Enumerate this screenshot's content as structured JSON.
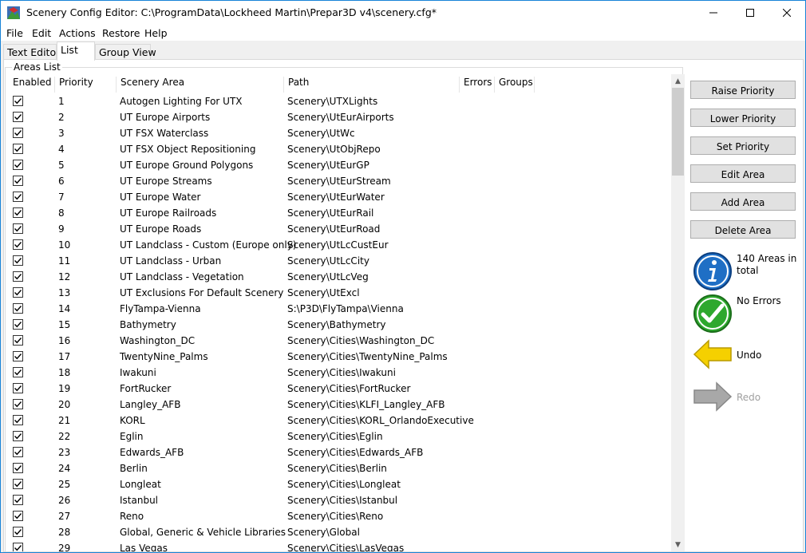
{
  "window": {
    "title": "Scenery Config Editor: C:\\ProgramData\\Lockheed Martin\\Prepar3D v4\\scenery.cfg*"
  },
  "menu": [
    "File",
    "Edit",
    "Actions",
    "Restore",
    "Help"
  ],
  "tabs": [
    {
      "label": "Text Editor",
      "active": false
    },
    {
      "label": "List",
      "active": true
    },
    {
      "label": "Group View",
      "active": false
    }
  ],
  "areas_list": {
    "group_label": "Areas List",
    "columns": [
      "Enabled",
      "Priority",
      "Scenery Area",
      "Path",
      "Errors",
      "Groups"
    ],
    "rows": [
      {
        "priority": "1",
        "area": "Autogen Lighting For UTX",
        "path": "Scenery\\UTXLights"
      },
      {
        "priority": "2",
        "area": "UT Europe Airports",
        "path": "Scenery\\UtEurAirports"
      },
      {
        "priority": "3",
        "area": "UT FSX Waterclass",
        "path": "Scenery\\UtWc"
      },
      {
        "priority": "4",
        "area": "UT FSX Object Repositioning",
        "path": "Scenery\\UtObjRepo"
      },
      {
        "priority": "5",
        "area": "UT Europe Ground Polygons",
        "path": "Scenery\\UtEurGP"
      },
      {
        "priority": "6",
        "area": "UT Europe Streams",
        "path": "Scenery\\UtEurStream"
      },
      {
        "priority": "7",
        "area": "UT Europe Water",
        "path": "Scenery\\UtEurWater"
      },
      {
        "priority": "8",
        "area": "UT Europe Railroads",
        "path": "Scenery\\UtEurRail"
      },
      {
        "priority": "9",
        "area": "UT Europe Roads",
        "path": "Scenery\\UtEurRoad"
      },
      {
        "priority": "10",
        "area": "UT Landclass - Custom (Europe only)",
        "path": "Scenery\\UtLcCustEur"
      },
      {
        "priority": "11",
        "area": "UT Landclass - Urban",
        "path": "Scenery\\UtLcCity"
      },
      {
        "priority": "12",
        "area": "UT Landclass - Vegetation",
        "path": "Scenery\\UtLcVeg"
      },
      {
        "priority": "13",
        "area": "UT Exclusions For Default Scenery",
        "path": "Scenery\\UtExcl"
      },
      {
        "priority": "14",
        "area": "FlyTampa-Vienna",
        "path": "S:\\P3D\\FlyTampa\\Vienna"
      },
      {
        "priority": "15",
        "area": "Bathymetry",
        "path": "Scenery\\Bathymetry"
      },
      {
        "priority": "16",
        "area": "Washington_DC",
        "path": "Scenery\\Cities\\Washington_DC"
      },
      {
        "priority": "17",
        "area": "TwentyNine_Palms",
        "path": "Scenery\\Cities\\TwentyNine_Palms"
      },
      {
        "priority": "18",
        "area": "Iwakuni",
        "path": "Scenery\\Cities\\Iwakuni"
      },
      {
        "priority": "19",
        "area": "FortRucker",
        "path": "Scenery\\Cities\\FortRucker"
      },
      {
        "priority": "20",
        "area": "Langley_AFB",
        "path": "Scenery\\Cities\\KLFI_Langley_AFB"
      },
      {
        "priority": "21",
        "area": "KORL",
        "path": "Scenery\\Cities\\KORL_OrlandoExecutive"
      },
      {
        "priority": "22",
        "area": "Eglin",
        "path": "Scenery\\Cities\\Eglin"
      },
      {
        "priority": "23",
        "area": "Edwards_AFB",
        "path": "Scenery\\Cities\\Edwards_AFB"
      },
      {
        "priority": "24",
        "area": "Berlin",
        "path": "Scenery\\Cities\\Berlin"
      },
      {
        "priority": "25",
        "area": "Longleat",
        "path": "Scenery\\Cities\\Longleat"
      },
      {
        "priority": "26",
        "area": "Istanbul",
        "path": "Scenery\\Cities\\Istanbul"
      },
      {
        "priority": "27",
        "area": "Reno",
        "path": "Scenery\\Cities\\Reno"
      },
      {
        "priority": "28",
        "area": "Global, Generic & Vehicle Libraries",
        "path": "Scenery\\Global"
      },
      {
        "priority": "29",
        "area": "Las Vegas",
        "path": "Scenery\\Cities\\LasVegas"
      }
    ]
  },
  "side": {
    "buttons": [
      "Raise Priority",
      "Lower Priority",
      "Set Priority",
      "Edit Area",
      "Add Area",
      "Delete Area"
    ],
    "info_text": "140 Areas in total",
    "errors_text": "No Errors",
    "undo_label": "Undo",
    "redo_label": "Redo"
  },
  "colors": {
    "info_blue": "#1f6fc5",
    "ok_green": "#2ea82e",
    "undo_yellow": "#f5d000",
    "redo_gray": "#a8a8a8",
    "window_border": "#1883d7"
  },
  "icons": {
    "info": "info-icon",
    "ok": "checkmark-icon",
    "undo": "undo-arrow-icon",
    "redo": "redo-arrow-icon"
  }
}
